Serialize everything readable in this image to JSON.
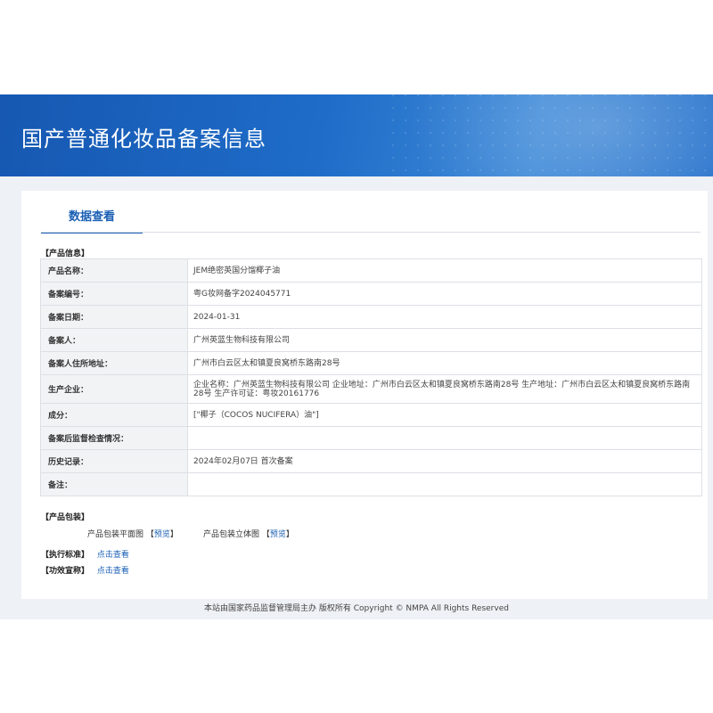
{
  "header": {
    "title": "国产普通化妆品备案信息"
  },
  "tabs": [
    {
      "label": "数据查看"
    }
  ],
  "product_info": {
    "section_title": "【产品信息】",
    "rows": [
      {
        "label": "产品名称：",
        "value": "JEM绝密英国分馏椰子油"
      },
      {
        "label": "备案编号：",
        "value": "粤G妆网备字2024045771"
      },
      {
        "label": "备案日期：",
        "value": "2024-01-31"
      },
      {
        "label": "备案人：",
        "value": "广州英蓝生物科技有限公司"
      },
      {
        "label": "备案人住所地址：",
        "value": "广州市白云区太和镇夏良窝桥东路南28号"
      },
      {
        "label": "生产企业：",
        "value": "企业名称：广州英蓝生物科技有限公司 企业地址：广州市白云区太和镇夏良窝桥东路南28号 生产地址：广州市白云区太和镇夏良窝桥东路南28号 生产许可证：粤妆20161776"
      },
      {
        "label": "成分：",
        "value": "[\"椰子（COCOS NUCIFERA）油\"]"
      },
      {
        "label": "备案后监督检查情况：",
        "value": ""
      },
      {
        "label": "历史记录：",
        "value": "2024年02月07日 首次备案"
      },
      {
        "label": "备注：",
        "value": ""
      }
    ]
  },
  "packaging": {
    "section_title": "【产品包装】",
    "flat_label": "产品包装平面图",
    "flat_link": "预览",
    "solid_label": "产品包装立体图",
    "solid_link": "预览"
  },
  "standard": {
    "label": "【执行标准】",
    "link": "点击查看"
  },
  "efficacy": {
    "label": "【功效宣称】",
    "link": "点击查看"
  },
  "footer": {
    "text": "本站由国家药品监督管理局主办 版权所有 Copyright © NMPA All Rights Reserved"
  }
}
